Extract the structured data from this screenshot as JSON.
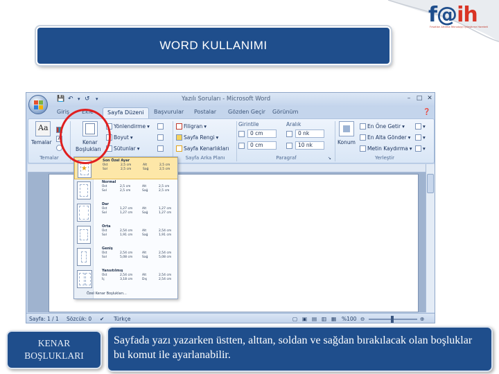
{
  "logo": {
    "text_main": "f@",
    "text_tail": "ih",
    "tagline": "Fırsatları Artırma Teknolojiyi İyileştirme Hareketi"
  },
  "title": "WORD KULLANIMI",
  "word": {
    "window_title": "Yazılı Soruları - Microsoft Word",
    "tabs": [
      "Giriş",
      "Ekle",
      "Sayfa Düzeni",
      "Başvurular",
      "Postalar",
      "Gözden Geçir",
      "Görünüm"
    ],
    "active_tab": "Sayfa Düzeni",
    "ribbon": {
      "temalar": {
        "button": "Temalar",
        "group": "Temalar"
      },
      "sayfa_yapisi": {
        "kenar_button_line1": "Kenar",
        "kenar_button_line2": "Boşlukları",
        "yonlendirme": "Yönlendirme",
        "boyut": "Boyut",
        "sutunlar": "Sütunlar"
      },
      "sayfa_arka_plani": {
        "filigran": "Filigran",
        "sayfa_rengi": "Sayfa Rengi",
        "sayfa_kenarliklari": "Sayfa Kenarlıkları",
        "group": "Sayfa Arka Planı"
      },
      "paragraf": {
        "girintile": "Girintile",
        "aralik": "Aralık",
        "left_value": "0 cm",
        "right_value": "0 cm",
        "before_value": "0 nk",
        "after_value": "10 nk",
        "group": "Paragraf"
      },
      "yerlestir": {
        "konum": "Konum",
        "one_getir": "En Öne Getir",
        "alta_gonder": "En Alta Gönder",
        "metin_kaydirma": "Metin Kaydırma",
        "group": "Yerleştir"
      }
    },
    "margins_menu": {
      "options": [
        {
          "name": "Son Özel Ayar",
          "ust": "2,5 cm",
          "alt": "2,5 cm",
          "sol": "2,5 cm",
          "sag": "2,5 cm"
        },
        {
          "name": "Normal",
          "ust": "2,5 cm",
          "alt": "2,5 cm",
          "sol": "2,5 cm",
          "sag": "2,5 cm"
        },
        {
          "name": "Dar",
          "ust": "1,27 cm",
          "alt": "1,27 cm",
          "sol": "1,27 cm",
          "sag": "1,27 cm"
        },
        {
          "name": "Orta",
          "ust": "2,54 cm",
          "alt": "2,54 cm",
          "sol": "1,91 cm",
          "sag": "1,91 cm"
        },
        {
          "name": "Geniş",
          "ust": "2,54 cm",
          "alt": "2,54 cm",
          "sol": "5,08 cm",
          "sag": "5,08 cm"
        },
        {
          "name": "Yansıtılmış",
          "ust": "2,54 cm",
          "alt": "2,54 cm",
          "sol": "3,18 cm",
          "sag": "2,54 cm"
        }
      ],
      "labels": {
        "ust": "Üst",
        "alt": "Alt",
        "sol": "Sol",
        "sag": "Sağ",
        "ic": "İç",
        "dis": "Dış"
      },
      "custom": "Özel Kenar Boşlukları..."
    },
    "status": {
      "page": "Sayfa: 1 / 1",
      "words": "Sözcük: 0",
      "language": "Türkçe",
      "zoom": "%100"
    }
  },
  "captions": {
    "left": "KENAR\nBOŞLUKLARI",
    "right": "Sayfada yazı yazarken  üstten, alttan, soldan ve sağdan bırakılacak olan boşluklar bu komut ile ayarlanabilir."
  },
  "colors": {
    "title_bg": "#1f4e8c",
    "highlight": "#e01f1f",
    "logo_red": "#d93425"
  }
}
